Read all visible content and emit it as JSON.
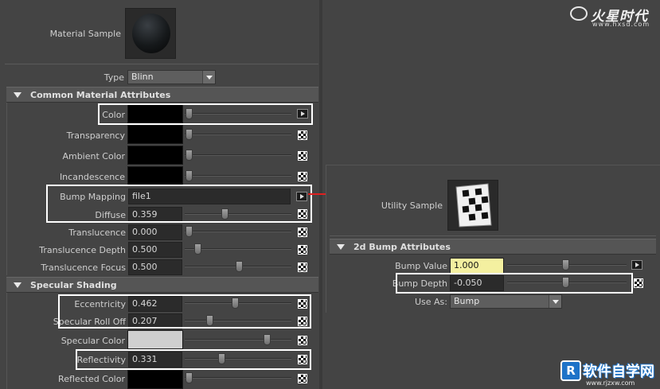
{
  "watermark_top": {
    "logo_text": "火星时代",
    "url": "www.hxsd.com"
  },
  "watermark_bottom": {
    "logo_text": "软件自学网",
    "url": "www.rjzxw.com"
  },
  "material": {
    "sample_label": "Material Sample",
    "type_label": "Type",
    "type_value": "Blinn",
    "common_section": "Common Material Attributes",
    "rows": {
      "color": "Color",
      "transparency": "Transparency",
      "ambient": "Ambient Color",
      "incandescence": "Incandescence",
      "bump_mapping": "Bump Mapping",
      "bump_mapping_value": "file1",
      "diffuse": "Diffuse",
      "diffuse_value": "0.359",
      "translucence": "Translucence",
      "translucence_value": "0.000",
      "translucence_depth": "Translucence Depth",
      "translucence_depth_value": "0.500",
      "translucence_focus": "Translucence Focus",
      "translucence_focus_value": "0.500"
    },
    "specular_section": "Specular Shading",
    "specular": {
      "eccentricity": "Eccentricity",
      "eccentricity_value": "0.462",
      "roll_off": "Specular Roll Off",
      "roll_off_value": "0.207",
      "spec_color": "Specular Color",
      "reflectivity": "Reflectivity",
      "reflectivity_value": "0.331",
      "reflected_color": "Reflected Color"
    },
    "slider_levels": {
      "diffuse": 0.359,
      "translucence": 0.0,
      "translucence_depth": 0.5,
      "translucence_focus": 0.5,
      "eccentricity": 0.462,
      "roll_off": 0.207,
      "reflectivity": 0.331
    }
  },
  "utility": {
    "sample_label": "Utility Sample",
    "section": "2d Bump Attributes",
    "bump_value_label": "Bump Value",
    "bump_value": "1.000",
    "bump_depth_label": "Bump Depth",
    "bump_depth": "-0.050",
    "use_as_label": "Use As:",
    "use_as_value": "Bump"
  },
  "colors": {
    "highlight": "#ffffff",
    "arrow": "#e02020",
    "bump_value_field": "#f4f0a0"
  }
}
